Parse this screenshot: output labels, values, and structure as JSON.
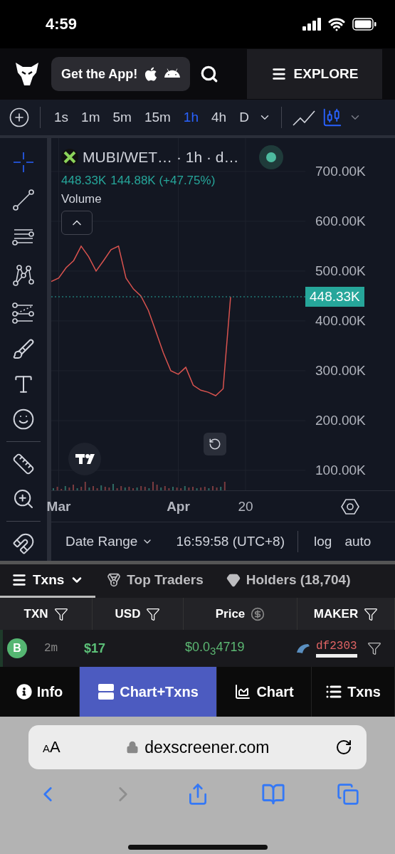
{
  "status_bar": {
    "time": "4:59"
  },
  "header": {
    "app_button": "Get the App!",
    "explore": "EXPLORE"
  },
  "toolbar": {
    "intervals": [
      {
        "label": "1s",
        "selected": false
      },
      {
        "label": "1m",
        "selected": false
      },
      {
        "label": "5m",
        "selected": false
      },
      {
        "label": "15m",
        "selected": false
      },
      {
        "label": "1h",
        "selected": true
      },
      {
        "label": "4h",
        "selected": false
      },
      {
        "label": "D",
        "selected": false
      }
    ],
    "chart_types": [
      {
        "kind": "line",
        "selected": false
      },
      {
        "kind": "candles",
        "selected": true
      }
    ]
  },
  "drawing_tools": [
    {
      "kind": "crosshair",
      "selected": true
    },
    {
      "kind": "trend",
      "selected": false
    },
    {
      "kind": "channel",
      "selected": false
    },
    {
      "kind": "pattern",
      "selected": false
    },
    {
      "kind": "fib",
      "selected": false
    },
    {
      "kind": "brush",
      "selected": false
    },
    {
      "kind": "text",
      "selected": false
    },
    {
      "kind": "emoji",
      "selected": false
    },
    {
      "kind": "divider"
    },
    {
      "kind": "ruler",
      "selected": false
    },
    {
      "kind": "zoom",
      "selected": false
    },
    {
      "kind": "divider"
    },
    {
      "kind": "magnet",
      "selected": false
    }
  ],
  "chart": {
    "symbol": "MUBI/WET…",
    "interval": "· 1h · d…",
    "live": true,
    "last": "448.33K",
    "change": "144.88K (+47.75%)",
    "study": "Volume",
    "price_tag": "448.33K",
    "chart_data": {
      "type": "line",
      "categories": [
        null,
        "Mar",
        null,
        null,
        null,
        null,
        null,
        null,
        null,
        null,
        null,
        null,
        null,
        null,
        null,
        null,
        null,
        "Apr",
        null,
        null,
        null,
        null,
        null,
        null,
        null,
        null,
        "20",
        null,
        null,
        null,
        null,
        null,
        null,
        null,
        null
      ],
      "series": [
        {
          "color": "#d9534f",
          "values": [
            479000,
            486000,
            507000,
            521000,
            550000,
            529000,
            500000,
            521000,
            543000,
            550000,
            486000,
            464000,
            450000,
            421000,
            379000,
            336000,
            300000,
            293000,
            307000,
            271000,
            261000,
            257000,
            250000,
            264000,
            448000,
            null,
            null,
            null,
            null,
            null,
            null,
            null,
            null,
            null,
            null
          ]
        }
      ],
      "ylim": [
        60000,
        767000
      ],
      "grid": true,
      "yticks": [
        {
          "value": 700000,
          "label": "700.00K"
        },
        {
          "value": 600000,
          "label": "600.00K"
        },
        {
          "value": 500000,
          "label": "500.00K"
        },
        {
          "value": 400000,
          "label": "400.00K"
        },
        {
          "value": 300000,
          "label": "300.00K"
        },
        {
          "value": 200000,
          "label": "200.00K"
        },
        {
          "value": 100000,
          "label": "100.00K"
        }
      ]
    }
  },
  "chart_footer": {
    "date_range": "Date Range",
    "time": "16:59:58 (UTC+8)",
    "options": [
      "log",
      "auto"
    ]
  },
  "tabs": [
    {
      "kind": "txns",
      "label": "Txns",
      "selected": true
    },
    {
      "kind": "traders",
      "label": "Top Traders",
      "selected": false
    },
    {
      "kind": "holders",
      "label": "Holders (18,704)",
      "selected": false
    }
  ],
  "table": {
    "columns": [
      {
        "label": "TXN",
        "kind": "filter"
      },
      {
        "label": "USD",
        "kind": "filter"
      },
      {
        "label": "Price",
        "kind": "currency"
      },
      {
        "label": "MAKER",
        "kind": "filter"
      }
    ],
    "rows": [
      {
        "kind": "buy",
        "type": "B",
        "age": "2m",
        "usd": "$17",
        "price": "$0.0$_{3}$4719",
        "maker": "df2303"
      }
    ]
  },
  "bottom_nav": [
    {
      "kind": "info",
      "label": "Info",
      "selected": false
    },
    {
      "kind": "split",
      "label": "Chart+Txns",
      "selected": true
    },
    {
      "kind": "chart",
      "label": "Chart",
      "selected": false
    },
    {
      "kind": "list",
      "label": "Txns",
      "selected": false
    }
  ],
  "browser": {
    "text_size": "AA",
    "url": "dexscreener.com"
  }
}
